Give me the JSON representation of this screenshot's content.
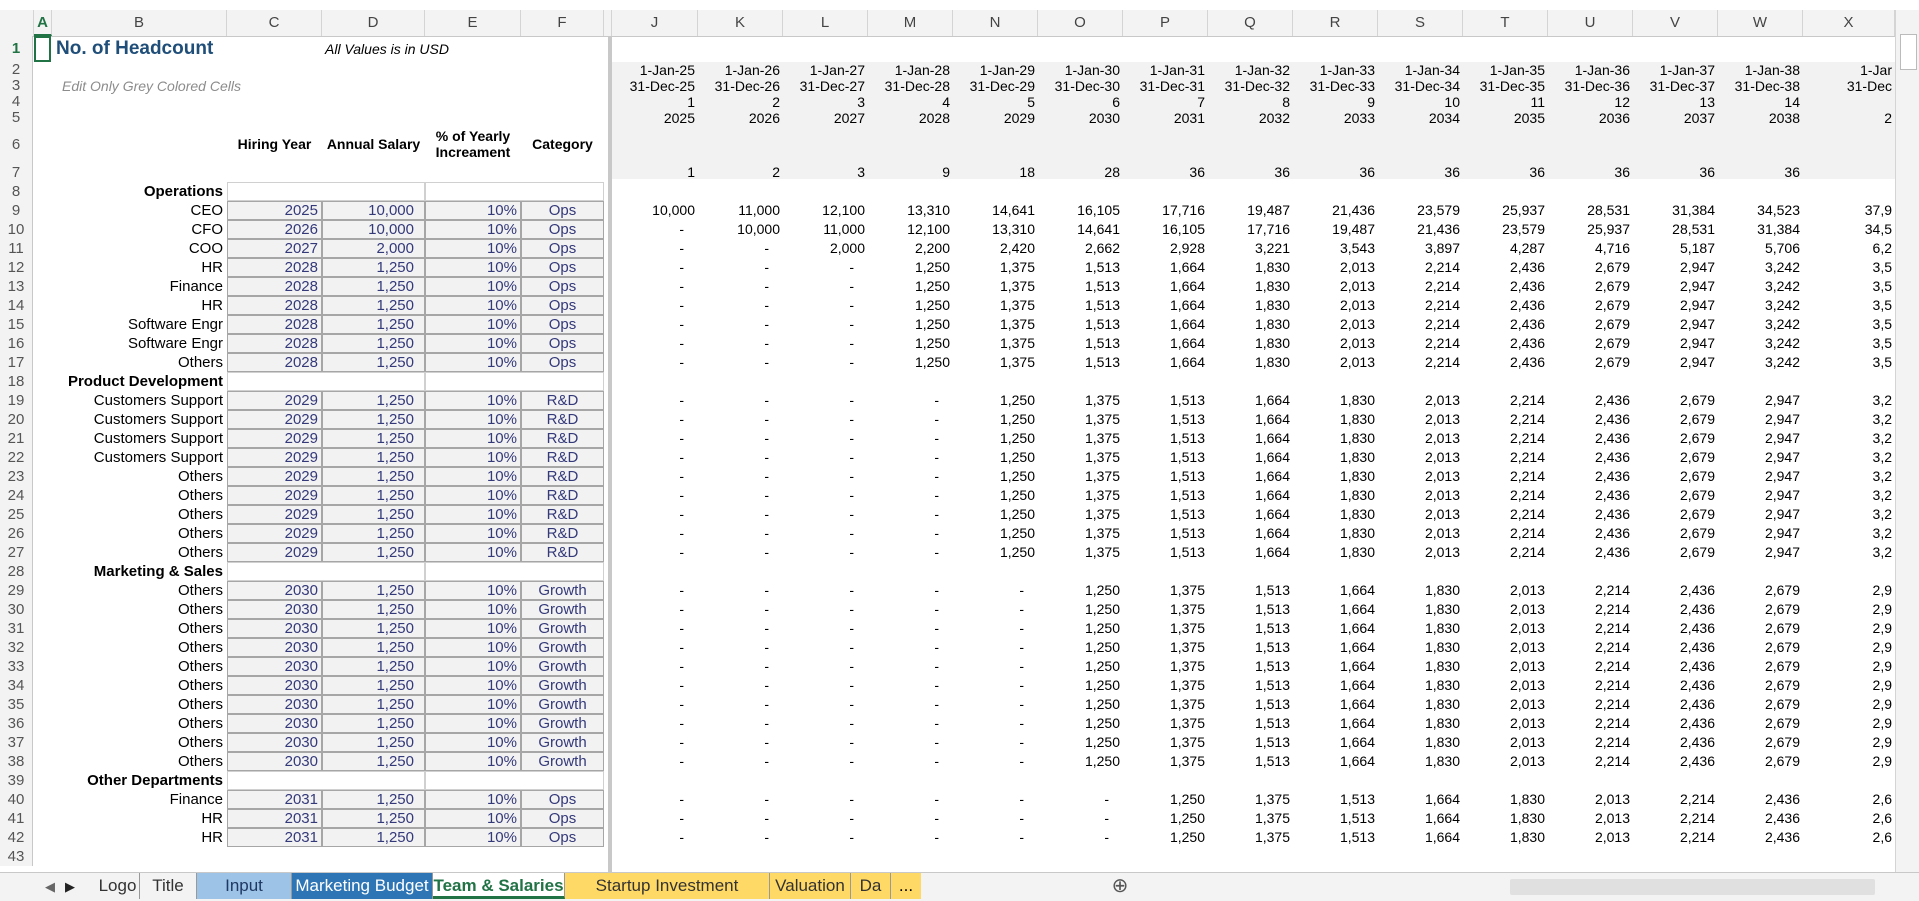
{
  "columns": [
    "A",
    "B",
    "C",
    "D",
    "E",
    "F",
    "",
    "J",
    "K",
    "L",
    "M",
    "N",
    "O",
    "P",
    "Q",
    "R",
    "S",
    "T",
    "U",
    "V",
    "W",
    "X"
  ],
  "selected_cell": "A1",
  "header": {
    "title": "No. of Headcount",
    "note": "All Values is in USD",
    "hint": "Edit Only Grey Colored Cells",
    "col_hiring_year": "Hiring Year",
    "col_annual_salary": "Annual Salary",
    "col_pct": "% of Yearly Increament",
    "col_category": "Category"
  },
  "periods": {
    "start": [
      "1-Jan-25",
      "1-Jan-26",
      "1-Jan-27",
      "1-Jan-28",
      "1-Jan-29",
      "1-Jan-30",
      "1-Jan-31",
      "1-Jan-32",
      "1-Jan-33",
      "1-Jan-34",
      "1-Jan-35",
      "1-Jan-36",
      "1-Jan-37",
      "1-Jan-38",
      "1-Jar"
    ],
    "end": [
      "31-Dec-25",
      "31-Dec-26",
      "31-Dec-27",
      "31-Dec-28",
      "31-Dec-29",
      "31-Dec-30",
      "31-Dec-31",
      "31-Dec-32",
      "31-Dec-33",
      "31-Dec-34",
      "31-Dec-35",
      "31-Dec-36",
      "31-Dec-37",
      "31-Dec-38",
      "31-Dec"
    ],
    "index": [
      "1",
      "2",
      "3",
      "4",
      "5",
      "6",
      "7",
      "8",
      "9",
      "10",
      "11",
      "12",
      "13",
      "14",
      ""
    ],
    "year": [
      "2025",
      "2026",
      "2027",
      "2028",
      "2029",
      "2030",
      "2031",
      "2032",
      "2033",
      "2034",
      "2035",
      "2036",
      "2037",
      "2038",
      "2"
    ],
    "headcount": [
      "1",
      "2",
      "3",
      "9",
      "18",
      "28",
      "36",
      "36",
      "36",
      "36",
      "36",
      "36",
      "36",
      "36",
      ""
    ]
  },
  "rows": [
    {
      "n": "8",
      "label": "Operations",
      "section": true
    },
    {
      "n": "9",
      "label": "CEO",
      "year": "2025",
      "salary": "10,000",
      "pct": "10%",
      "cat": "Ops",
      "v": [
        "10,000",
        "11,000",
        "12,100",
        "13,310",
        "14,641",
        "16,105",
        "17,716",
        "19,487",
        "21,436",
        "23,579",
        "25,937",
        "28,531",
        "31,384",
        "34,523",
        "37,9"
      ]
    },
    {
      "n": "10",
      "label": "CFO",
      "year": "2026",
      "salary": "10,000",
      "pct": "10%",
      "cat": "Ops",
      "v": [
        "-",
        "10,000",
        "11,000",
        "12,100",
        "13,310",
        "14,641",
        "16,105",
        "17,716",
        "19,487",
        "21,436",
        "23,579",
        "25,937",
        "28,531",
        "31,384",
        "34,5"
      ]
    },
    {
      "n": "11",
      "label": "COO",
      "year": "2027",
      "salary": "2,000",
      "pct": "10%",
      "cat": "Ops",
      "v": [
        "-",
        "-",
        "2,000",
        "2,200",
        "2,420",
        "2,662",
        "2,928",
        "3,221",
        "3,543",
        "3,897",
        "4,287",
        "4,716",
        "5,187",
        "5,706",
        "6,2"
      ]
    },
    {
      "n": "12",
      "label": "HR",
      "year": "2028",
      "salary": "1,250",
      "pct": "10%",
      "cat": "Ops",
      "v": [
        "-",
        "-",
        "-",
        "1,250",
        "1,375",
        "1,513",
        "1,664",
        "1,830",
        "2,013",
        "2,214",
        "2,436",
        "2,679",
        "2,947",
        "3,242",
        "3,5"
      ]
    },
    {
      "n": "13",
      "label": "Finance",
      "year": "2028",
      "salary": "1,250",
      "pct": "10%",
      "cat": "Ops",
      "v": [
        "-",
        "-",
        "-",
        "1,250",
        "1,375",
        "1,513",
        "1,664",
        "1,830",
        "2,013",
        "2,214",
        "2,436",
        "2,679",
        "2,947",
        "3,242",
        "3,5"
      ]
    },
    {
      "n": "14",
      "label": "HR",
      "year": "2028",
      "salary": "1,250",
      "pct": "10%",
      "cat": "Ops",
      "v": [
        "-",
        "-",
        "-",
        "1,250",
        "1,375",
        "1,513",
        "1,664",
        "1,830",
        "2,013",
        "2,214",
        "2,436",
        "2,679",
        "2,947",
        "3,242",
        "3,5"
      ]
    },
    {
      "n": "15",
      "label": "Software Engr",
      "year": "2028",
      "salary": "1,250",
      "pct": "10%",
      "cat": "Ops",
      "v": [
        "-",
        "-",
        "-",
        "1,250",
        "1,375",
        "1,513",
        "1,664",
        "1,830",
        "2,013",
        "2,214",
        "2,436",
        "2,679",
        "2,947",
        "3,242",
        "3,5"
      ]
    },
    {
      "n": "16",
      "label": "Software Engr",
      "year": "2028",
      "salary": "1,250",
      "pct": "10%",
      "cat": "Ops",
      "v": [
        "-",
        "-",
        "-",
        "1,250",
        "1,375",
        "1,513",
        "1,664",
        "1,830",
        "2,013",
        "2,214",
        "2,436",
        "2,679",
        "2,947",
        "3,242",
        "3,5"
      ]
    },
    {
      "n": "17",
      "label": "Others",
      "year": "2028",
      "salary": "1,250",
      "pct": "10%",
      "cat": "Ops",
      "v": [
        "-",
        "-",
        "-",
        "1,250",
        "1,375",
        "1,513",
        "1,664",
        "1,830",
        "2,013",
        "2,214",
        "2,436",
        "2,679",
        "2,947",
        "3,242",
        "3,5"
      ]
    },
    {
      "n": "18",
      "label": "Product Development",
      "section": true
    },
    {
      "n": "19",
      "label": "Customers Support",
      "year": "2029",
      "salary": "1,250",
      "pct": "10%",
      "cat": "R&D",
      "v": [
        "-",
        "-",
        "-",
        "-",
        "1,250",
        "1,375",
        "1,513",
        "1,664",
        "1,830",
        "2,013",
        "2,214",
        "2,436",
        "2,679",
        "2,947",
        "3,2"
      ]
    },
    {
      "n": "20",
      "label": "Customers Support",
      "year": "2029",
      "salary": "1,250",
      "pct": "10%",
      "cat": "R&D",
      "v": [
        "-",
        "-",
        "-",
        "-",
        "1,250",
        "1,375",
        "1,513",
        "1,664",
        "1,830",
        "2,013",
        "2,214",
        "2,436",
        "2,679",
        "2,947",
        "3,2"
      ]
    },
    {
      "n": "21",
      "label": "Customers Support",
      "year": "2029",
      "salary": "1,250",
      "pct": "10%",
      "cat": "R&D",
      "v": [
        "-",
        "-",
        "-",
        "-",
        "1,250",
        "1,375",
        "1,513",
        "1,664",
        "1,830",
        "2,013",
        "2,214",
        "2,436",
        "2,679",
        "2,947",
        "3,2"
      ]
    },
    {
      "n": "22",
      "label": "Customers Support",
      "year": "2029",
      "salary": "1,250",
      "pct": "10%",
      "cat": "R&D",
      "v": [
        "-",
        "-",
        "-",
        "-",
        "1,250",
        "1,375",
        "1,513",
        "1,664",
        "1,830",
        "2,013",
        "2,214",
        "2,436",
        "2,679",
        "2,947",
        "3,2"
      ]
    },
    {
      "n": "23",
      "label": "Others",
      "year": "2029",
      "salary": "1,250",
      "pct": "10%",
      "cat": "R&D",
      "v": [
        "-",
        "-",
        "-",
        "-",
        "1,250",
        "1,375",
        "1,513",
        "1,664",
        "1,830",
        "2,013",
        "2,214",
        "2,436",
        "2,679",
        "2,947",
        "3,2"
      ]
    },
    {
      "n": "24",
      "label": "Others",
      "year": "2029",
      "salary": "1,250",
      "pct": "10%",
      "cat": "R&D",
      "v": [
        "-",
        "-",
        "-",
        "-",
        "1,250",
        "1,375",
        "1,513",
        "1,664",
        "1,830",
        "2,013",
        "2,214",
        "2,436",
        "2,679",
        "2,947",
        "3,2"
      ]
    },
    {
      "n": "25",
      "label": "Others",
      "year": "2029",
      "salary": "1,250",
      "pct": "10%",
      "cat": "R&D",
      "v": [
        "-",
        "-",
        "-",
        "-",
        "1,250",
        "1,375",
        "1,513",
        "1,664",
        "1,830",
        "2,013",
        "2,214",
        "2,436",
        "2,679",
        "2,947",
        "3,2"
      ]
    },
    {
      "n": "26",
      "label": "Others",
      "year": "2029",
      "salary": "1,250",
      "pct": "10%",
      "cat": "R&D",
      "v": [
        "-",
        "-",
        "-",
        "-",
        "1,250",
        "1,375",
        "1,513",
        "1,664",
        "1,830",
        "2,013",
        "2,214",
        "2,436",
        "2,679",
        "2,947",
        "3,2"
      ]
    },
    {
      "n": "27",
      "label": "Others",
      "year": "2029",
      "salary": "1,250",
      "pct": "10%",
      "cat": "R&D",
      "v": [
        "-",
        "-",
        "-",
        "-",
        "1,250",
        "1,375",
        "1,513",
        "1,664",
        "1,830",
        "2,013",
        "2,214",
        "2,436",
        "2,679",
        "2,947",
        "3,2"
      ]
    },
    {
      "n": "28",
      "label": "Marketing & Sales",
      "section": true
    },
    {
      "n": "29",
      "label": "Others",
      "year": "2030",
      "salary": "1,250",
      "pct": "10%",
      "cat": "Growth",
      "v": [
        "-",
        "-",
        "-",
        "-",
        "-",
        "1,250",
        "1,375",
        "1,513",
        "1,664",
        "1,830",
        "2,013",
        "2,214",
        "2,436",
        "2,679",
        "2,9"
      ]
    },
    {
      "n": "30",
      "label": "Others",
      "year": "2030",
      "salary": "1,250",
      "pct": "10%",
      "cat": "Growth",
      "v": [
        "-",
        "-",
        "-",
        "-",
        "-",
        "1,250",
        "1,375",
        "1,513",
        "1,664",
        "1,830",
        "2,013",
        "2,214",
        "2,436",
        "2,679",
        "2,9"
      ]
    },
    {
      "n": "31",
      "label": "Others",
      "year": "2030",
      "salary": "1,250",
      "pct": "10%",
      "cat": "Growth",
      "v": [
        "-",
        "-",
        "-",
        "-",
        "-",
        "1,250",
        "1,375",
        "1,513",
        "1,664",
        "1,830",
        "2,013",
        "2,214",
        "2,436",
        "2,679",
        "2,9"
      ]
    },
    {
      "n": "32",
      "label": "Others",
      "year": "2030",
      "salary": "1,250",
      "pct": "10%",
      "cat": "Growth",
      "v": [
        "-",
        "-",
        "-",
        "-",
        "-",
        "1,250",
        "1,375",
        "1,513",
        "1,664",
        "1,830",
        "2,013",
        "2,214",
        "2,436",
        "2,679",
        "2,9"
      ]
    },
    {
      "n": "33",
      "label": "Others",
      "year": "2030",
      "salary": "1,250",
      "pct": "10%",
      "cat": "Growth",
      "v": [
        "-",
        "-",
        "-",
        "-",
        "-",
        "1,250",
        "1,375",
        "1,513",
        "1,664",
        "1,830",
        "2,013",
        "2,214",
        "2,436",
        "2,679",
        "2,9"
      ]
    },
    {
      "n": "34",
      "label": "Others",
      "year": "2030",
      "salary": "1,250",
      "pct": "10%",
      "cat": "Growth",
      "v": [
        "-",
        "-",
        "-",
        "-",
        "-",
        "1,250",
        "1,375",
        "1,513",
        "1,664",
        "1,830",
        "2,013",
        "2,214",
        "2,436",
        "2,679",
        "2,9"
      ]
    },
    {
      "n": "35",
      "label": "Others",
      "year": "2030",
      "salary": "1,250",
      "pct": "10%",
      "cat": "Growth",
      "v": [
        "-",
        "-",
        "-",
        "-",
        "-",
        "1,250",
        "1,375",
        "1,513",
        "1,664",
        "1,830",
        "2,013",
        "2,214",
        "2,436",
        "2,679",
        "2,9"
      ]
    },
    {
      "n": "36",
      "label": "Others",
      "year": "2030",
      "salary": "1,250",
      "pct": "10%",
      "cat": "Growth",
      "v": [
        "-",
        "-",
        "-",
        "-",
        "-",
        "1,250",
        "1,375",
        "1,513",
        "1,664",
        "1,830",
        "2,013",
        "2,214",
        "2,436",
        "2,679",
        "2,9"
      ]
    },
    {
      "n": "37",
      "label": "Others",
      "year": "2030",
      "salary": "1,250",
      "pct": "10%",
      "cat": "Growth",
      "v": [
        "-",
        "-",
        "-",
        "-",
        "-",
        "1,250",
        "1,375",
        "1,513",
        "1,664",
        "1,830",
        "2,013",
        "2,214",
        "2,436",
        "2,679",
        "2,9"
      ]
    },
    {
      "n": "38",
      "label": "Others",
      "year": "2030",
      "salary": "1,250",
      "pct": "10%",
      "cat": "Growth",
      "v": [
        "-",
        "-",
        "-",
        "-",
        "-",
        "1,250",
        "1,375",
        "1,513",
        "1,664",
        "1,830",
        "2,013",
        "2,214",
        "2,436",
        "2,679",
        "2,9"
      ]
    },
    {
      "n": "39",
      "label": "Other Departments",
      "section": true
    },
    {
      "n": "40",
      "label": "Finance",
      "year": "2031",
      "salary": "1,250",
      "pct": "10%",
      "cat": "Ops",
      "v": [
        "-",
        "-",
        "-",
        "-",
        "-",
        "-",
        "1,250",
        "1,375",
        "1,513",
        "1,664",
        "1,830",
        "2,013",
        "2,214",
        "2,436",
        "2,6"
      ]
    },
    {
      "n": "41",
      "label": "HR",
      "year": "2031",
      "salary": "1,250",
      "pct": "10%",
      "cat": "Ops",
      "v": [
        "-",
        "-",
        "-",
        "-",
        "-",
        "-",
        "1,250",
        "1,375",
        "1,513",
        "1,664",
        "1,830",
        "2,013",
        "2,214",
        "2,436",
        "2,6"
      ]
    },
    {
      "n": "42",
      "label": "HR",
      "year": "2031",
      "salary": "1,250",
      "pct": "10%",
      "cat": "Ops",
      "v": [
        "-",
        "-",
        "-",
        "-",
        "-",
        "-",
        "1,250",
        "1,375",
        "1,513",
        "1,664",
        "1,830",
        "2,013",
        "2,214",
        "2,436",
        "2,6"
      ]
    }
  ],
  "tabs": [
    {
      "label": "Logo",
      "color": "#f3f3f3",
      "text": "#333",
      "active": false
    },
    {
      "label": "Title",
      "color": "#f3f3f3",
      "text": "#333",
      "active": false
    },
    {
      "label": "Input Drivers",
      "color": "#9dc3e6",
      "text": "#1f3864",
      "active": false
    },
    {
      "label": "Marketing Budget",
      "color": "#2e75b6",
      "text": "#ffffff",
      "active": false
    },
    {
      "label": "Team & Salaries",
      "color": "#ffffff",
      "text": "#217346",
      "active": true
    },
    {
      "label": "Startup Investment Summary",
      "color": "#ffd966",
      "text": "#333",
      "active": false
    },
    {
      "label": "Valuation",
      "color": "#ffd966",
      "text": "#333",
      "active": false
    },
    {
      "label": "Da",
      "color": "#ffd966",
      "text": "#333",
      "active": false
    }
  ],
  "tab_more": "...",
  "add_sheet": "⊕"
}
